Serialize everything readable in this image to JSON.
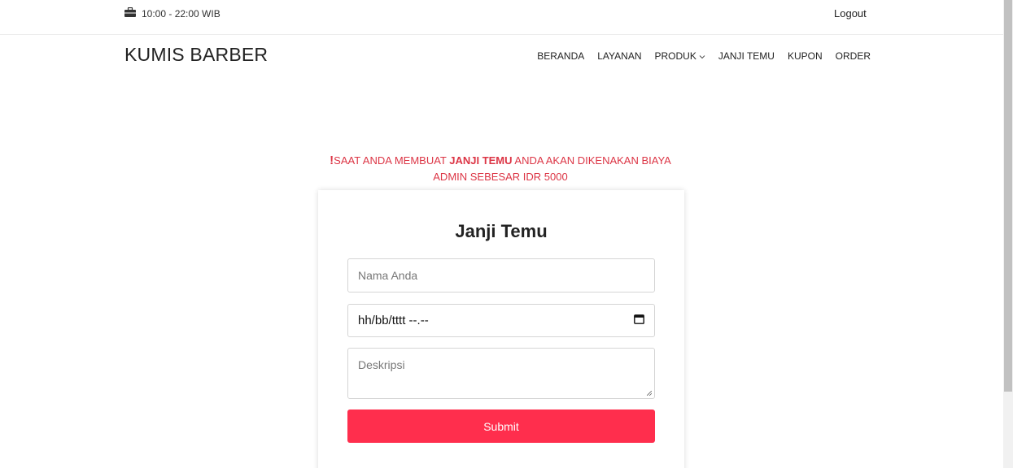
{
  "topbar": {
    "hours": "10:00 - 22:00 WIB",
    "hours_icon": "briefcase-icon",
    "logout_label": "Logout"
  },
  "header": {
    "brand": "KUMIS BARBER",
    "nav": [
      {
        "label": "BERANDA"
      },
      {
        "label": "LAYANAN"
      },
      {
        "label": "PRODUK",
        "has_dropdown": true
      },
      {
        "label": "JANJI TEMU"
      },
      {
        "label": "KUPON"
      },
      {
        "label": "ORDER"
      }
    ]
  },
  "notice": {
    "icon": "exclamation-icon",
    "prefix": "SAAT ANDA MEMBUAT ",
    "highlight": "JANJI TEMU",
    "suffix": " ANDA AKAN DIKENAKAN BIAYA ADMIN SEBESAR IDR 5000",
    "color": "#dc3545"
  },
  "form": {
    "title": "Janji Temu",
    "name_placeholder": "Nama Anda",
    "name_value": "",
    "datetime_placeholder": "hh/bb/tttt --.--",
    "description_placeholder": "Deskripsi",
    "description_value": "",
    "submit_label": "Submit",
    "submit_color": "#ff2e4d"
  }
}
